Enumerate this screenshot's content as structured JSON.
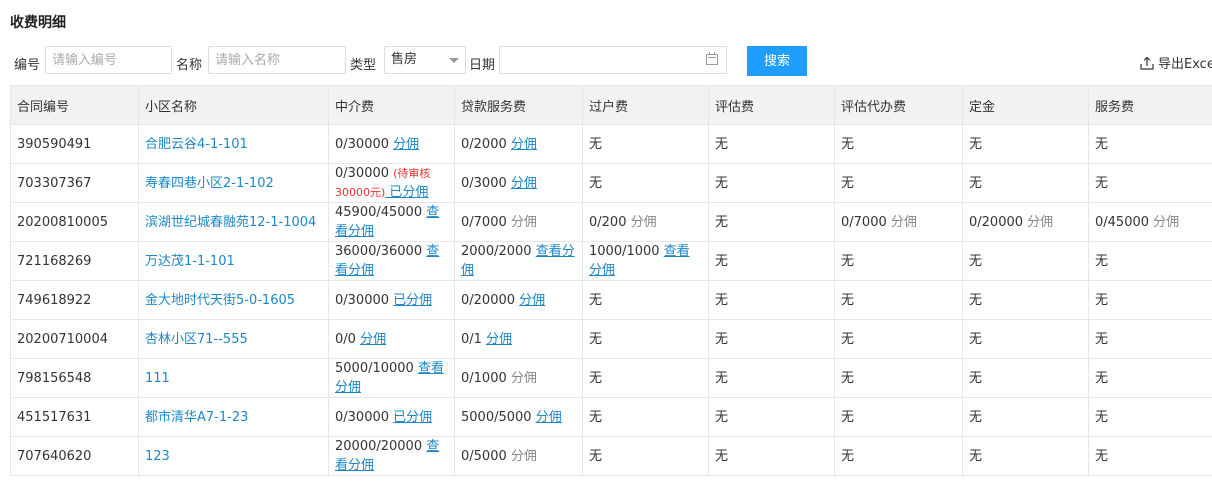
{
  "page_title": "收费明细",
  "filters": {
    "id_label": "编号",
    "id_placeholder": "请输入编号",
    "name_label": "名称",
    "name_placeholder": "请输入名称",
    "type_label": "类型",
    "type_value": "售房",
    "date_label": "日期",
    "search_label": "搜索",
    "export_label": "导出Excel"
  },
  "table": {
    "columns": [
      "合同编号",
      "小区名称",
      "中介费",
      "贷款服务费",
      "过户费",
      "评估费",
      "评估代办费",
      "定金",
      "服务费"
    ],
    "rows": [
      {
        "contract": "390590491",
        "community": "合肥云谷4-1-101",
        "fees": [
          {
            "value": "0/30000 ",
            "link": "分佣"
          },
          {
            "value": "0/2000 ",
            "link": "分佣"
          },
          {
            "value": "无"
          },
          {
            "value": "无"
          },
          {
            "value": "无"
          },
          {
            "value": "无"
          },
          {
            "value": "无"
          }
        ]
      },
      {
        "contract": "703307367",
        "community": "寿春四巷小区2-1-102",
        "fees": [
          {
            "value": "0/30000 ",
            "note": "(待审核30000元)",
            "link": " 已分佣"
          },
          {
            "value": "0/3000 ",
            "link": "分佣"
          },
          {
            "value": "无"
          },
          {
            "value": "无"
          },
          {
            "value": "无"
          },
          {
            "value": "无"
          },
          {
            "value": "无"
          }
        ]
      },
      {
        "contract": "20200810005",
        "community": "滨湖世纪城春融苑12-1-1004",
        "fees": [
          {
            "value": "45900/45000 ",
            "link": "查看分佣"
          },
          {
            "value": "0/7000 ",
            "plain": "分佣"
          },
          {
            "value": "0/200 ",
            "plain": "分佣"
          },
          {
            "value": "无"
          },
          {
            "value": "0/7000 ",
            "plain": "分佣"
          },
          {
            "value": "0/20000 ",
            "plain": "分佣"
          },
          {
            "value": "0/45000 ",
            "plain": "分佣"
          }
        ]
      },
      {
        "contract": "721168269",
        "community": "万达茂1-1-101",
        "fees": [
          {
            "value": "36000/36000 ",
            "link": "查看分佣"
          },
          {
            "value": "2000/2000 ",
            "link": "查看分佣"
          },
          {
            "value": "1000/1000 ",
            "link": "查看分佣"
          },
          {
            "value": "无"
          },
          {
            "value": "无"
          },
          {
            "value": "无"
          },
          {
            "value": "无"
          }
        ]
      },
      {
        "contract": "749618922",
        "community": "金大地时代天街5-0-1605",
        "fees": [
          {
            "value": "0/30000 ",
            "link": "已分佣"
          },
          {
            "value": "0/20000 ",
            "link": "分佣"
          },
          {
            "value": "无"
          },
          {
            "value": "无"
          },
          {
            "value": "无"
          },
          {
            "value": "无"
          },
          {
            "value": "无"
          }
        ]
      },
      {
        "contract": "20200710004",
        "community": "杏林小区71--555",
        "fees": [
          {
            "value": "0/0 ",
            "link": "分佣"
          },
          {
            "value": "0/1 ",
            "link": "分佣"
          },
          {
            "value": "无"
          },
          {
            "value": "无"
          },
          {
            "value": "无"
          },
          {
            "value": "无"
          },
          {
            "value": "无"
          }
        ]
      },
      {
        "contract": "798156548",
        "community": "111",
        "fees": [
          {
            "value": "5000/10000 ",
            "link": "查看分佣"
          },
          {
            "value": "0/1000 ",
            "plain": "分佣"
          },
          {
            "value": "无"
          },
          {
            "value": "无"
          },
          {
            "value": "无"
          },
          {
            "value": "无"
          },
          {
            "value": "无"
          }
        ]
      },
      {
        "contract": "451517631",
        "community": "都市清华A7-1-23",
        "fees": [
          {
            "value": "0/30000 ",
            "link": "已分佣"
          },
          {
            "value": "5000/5000 ",
            "link": "分佣"
          },
          {
            "value": "无"
          },
          {
            "value": "无"
          },
          {
            "value": "无"
          },
          {
            "value": "无"
          },
          {
            "value": "无"
          }
        ]
      },
      {
        "contract": "707640620",
        "community": "123",
        "fees": [
          {
            "value": "20000/20000 ",
            "link": "查看分佣"
          },
          {
            "value": "0/5000 ",
            "plain": "分佣"
          },
          {
            "value": "无"
          },
          {
            "value": "无"
          },
          {
            "value": "无"
          },
          {
            "value": "无"
          },
          {
            "value": "无"
          }
        ]
      }
    ]
  },
  "colors": {
    "accent": "#1e9fff",
    "link": "#1e88c7",
    "pending": "#e53333",
    "header_bg": "#f2f2f2"
  }
}
